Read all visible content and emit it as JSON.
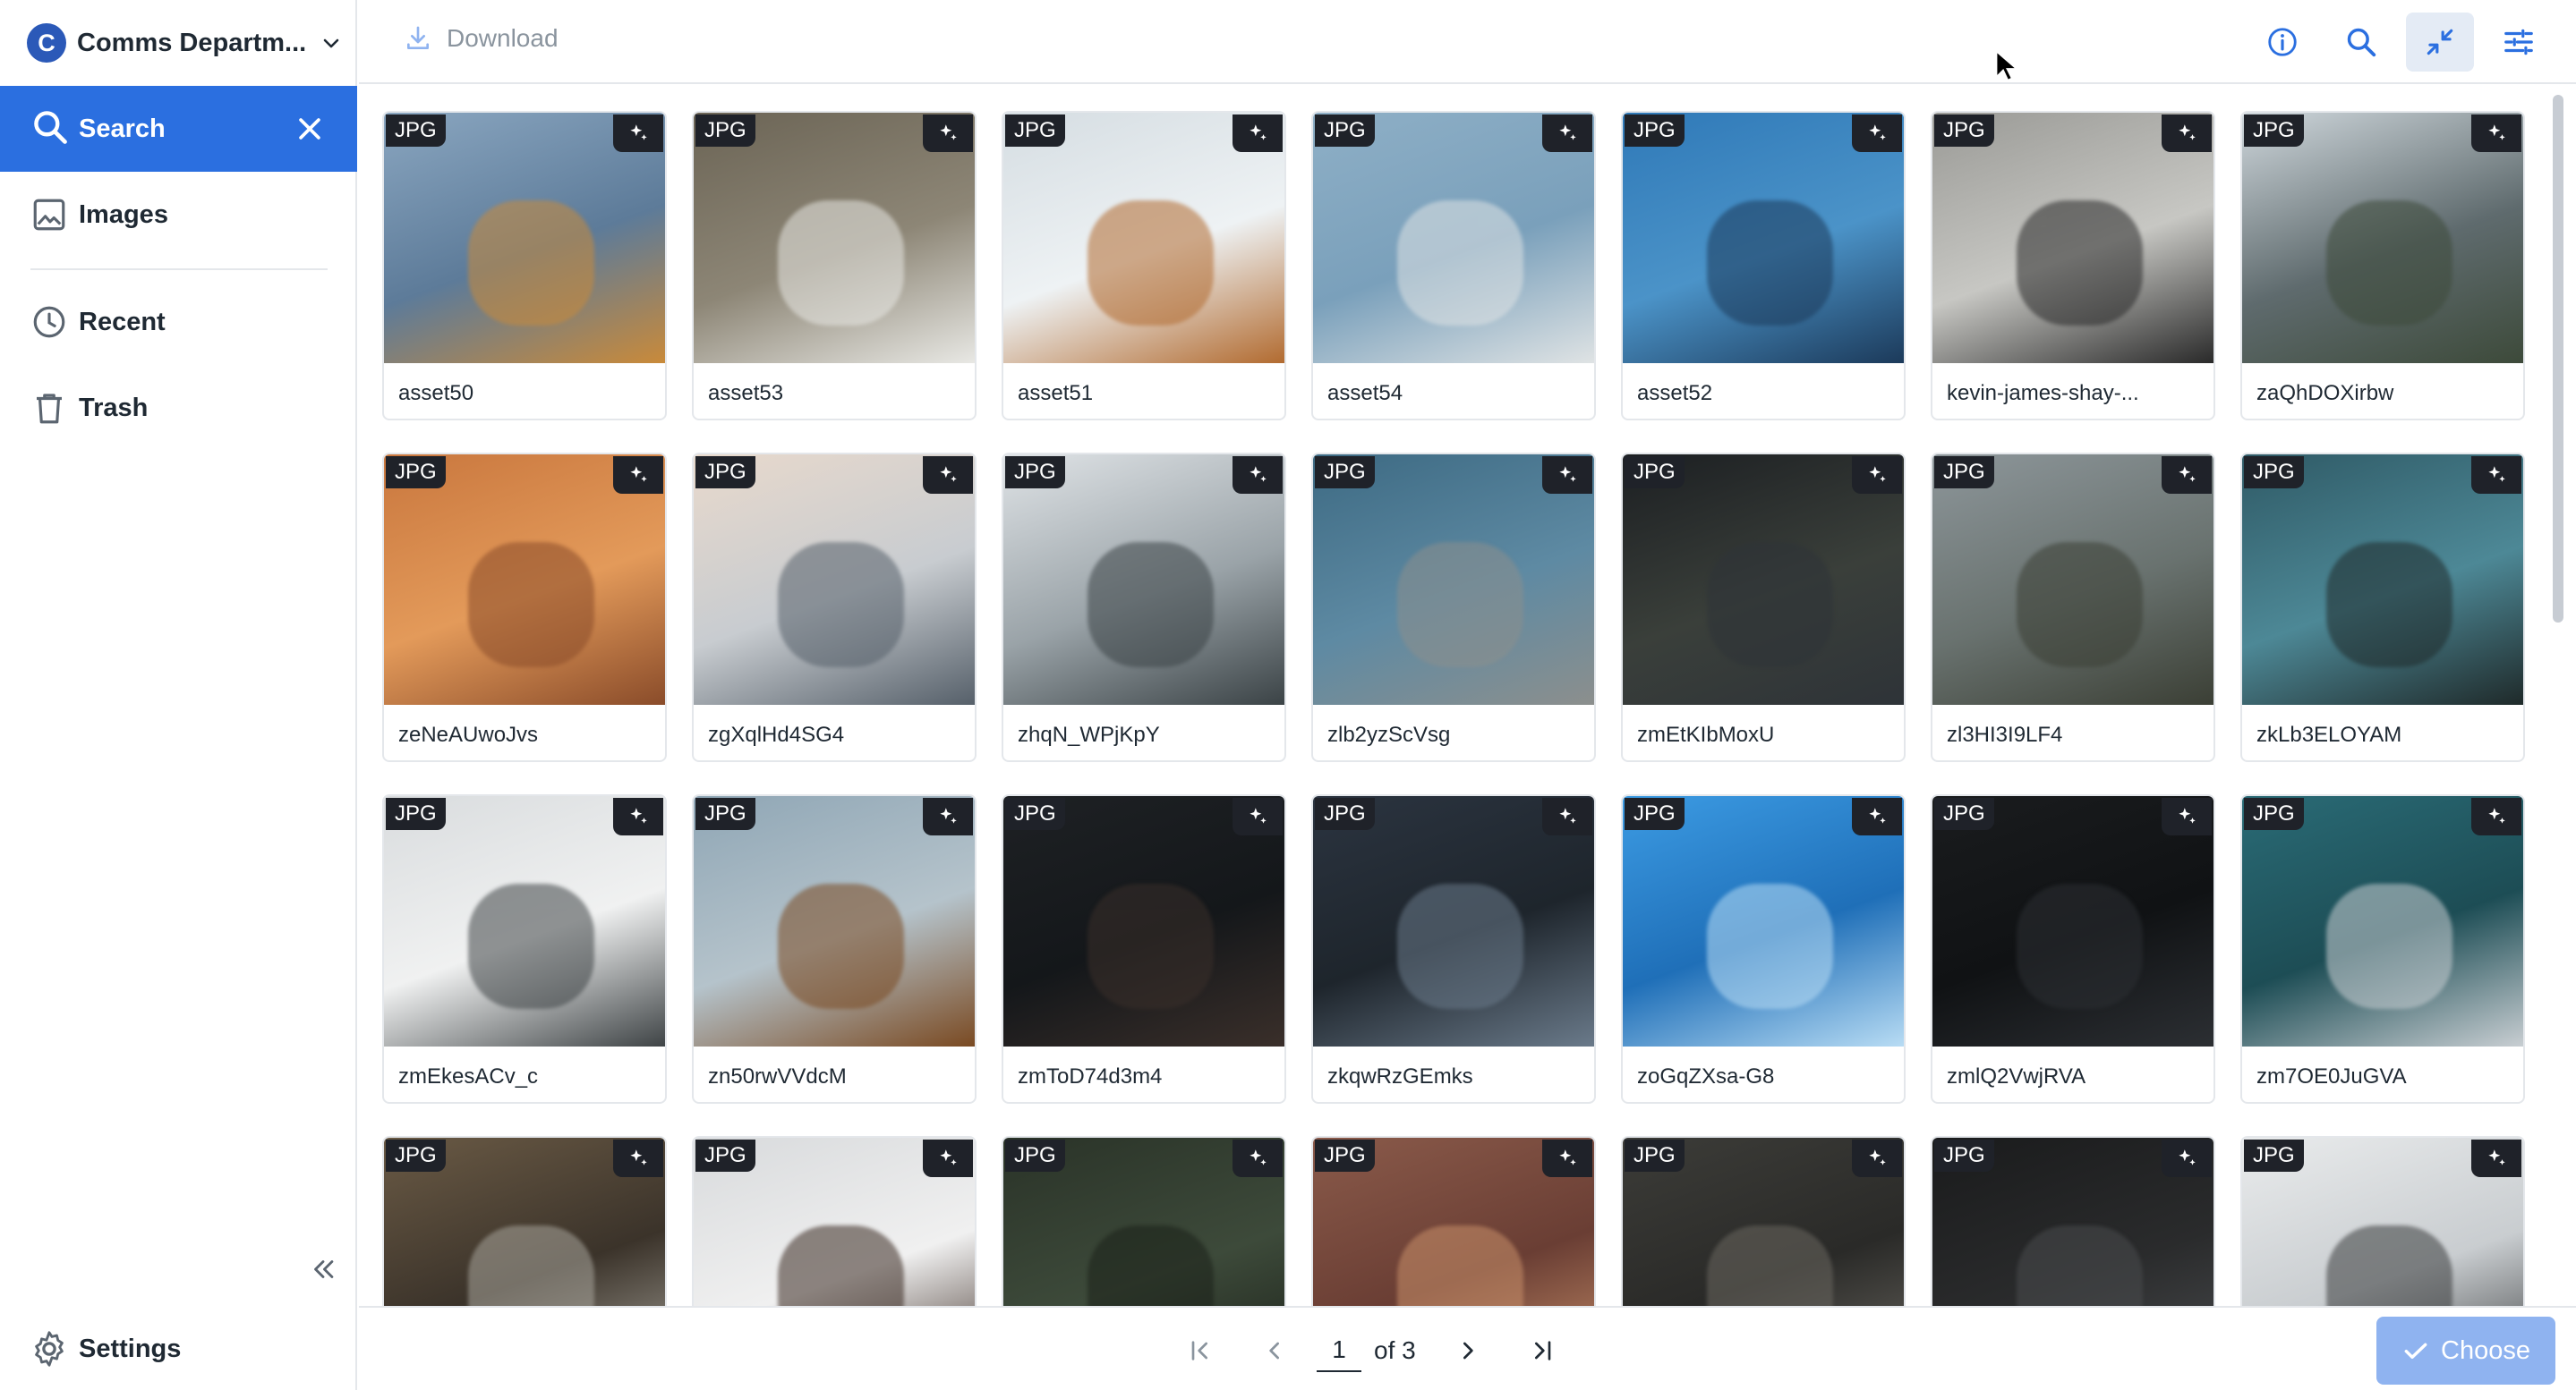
{
  "sidebar": {
    "workspace_initial": "C",
    "workspace_name": "Comms Departm...",
    "search_label": "Search",
    "items": [
      {
        "label": "Images",
        "icon": "image-icon"
      },
      {
        "label": "Recent",
        "icon": "clock-icon"
      },
      {
        "label": "Trash",
        "icon": "trash-icon"
      }
    ],
    "settings_label": "Settings"
  },
  "toolbar": {
    "download_label": "Download",
    "buttons": [
      "info-icon",
      "search-icon",
      "compress-icon",
      "filter-sliders-icon"
    ],
    "active_button": "compress-icon"
  },
  "assets": [
    {
      "name": "asset50",
      "type": "JPG",
      "img": "crane-tower",
      "colors": [
        "#8aa6c0",
        "#c98a3a",
        "#5d7b99"
      ]
    },
    {
      "name": "asset53",
      "type": "JPG",
      "img": "egret-water",
      "colors": [
        "#6b6455",
        "#e8e8e4",
        "#8d8676"
      ]
    },
    {
      "name": "asset51",
      "type": "JPG",
      "img": "crane-sky",
      "colors": [
        "#d5dde2",
        "#b26b30",
        "#eef2f4"
      ]
    },
    {
      "name": "asset54",
      "type": "JPG",
      "img": "egret-flying",
      "colors": [
        "#8eafc6",
        "#dfe3e4",
        "#7aa0bb"
      ]
    },
    {
      "name": "asset52",
      "type": "JPG",
      "img": "crane-blue",
      "colors": [
        "#2f79b8",
        "#1c3a5a",
        "#4b93c8"
      ]
    },
    {
      "name": "kevin-james-shay-...",
      "type": "JPG",
      "img": "protest-crowd",
      "colors": [
        "#9a9a96",
        "#2a2a2a",
        "#c7c7c3"
      ]
    },
    {
      "name": "zaQhDOXirbw",
      "type": "JPG",
      "img": "palm-beach",
      "colors": [
        "#cfd7dc",
        "#3d4a3a",
        "#5f6b6e"
      ]
    },
    {
      "name": "zeNeAUwoJvs",
      "type": "JPG",
      "img": "orange-village",
      "colors": [
        "#c9773e",
        "#8a4c2a",
        "#e39a5a"
      ]
    },
    {
      "name": "zgXqlHd4SG4",
      "type": "JPG",
      "img": "snowy-mountains",
      "colors": [
        "#e8d9cc",
        "#56606a",
        "#c8ccd0"
      ]
    },
    {
      "name": "zhqN_WPjKpY",
      "type": "JPG",
      "img": "snow-forest",
      "colors": [
        "#dfe3e6",
        "#3b4346",
        "#9aa3a8"
      ]
    },
    {
      "name": "zlb2yzScVsg",
      "type": "JPG",
      "img": "rocky-sea",
      "colors": [
        "#3d6a83",
        "#8c8f8d",
        "#5e8aa3"
      ]
    },
    {
      "name": "zmEtKIbMoxU",
      "type": "JPG",
      "img": "night-sky",
      "colors": [
        "#1c1f22",
        "#2e3338",
        "#3a3f3a"
      ]
    },
    {
      "name": "zl3HI3I9LF4",
      "type": "JPG",
      "img": "coast-cliff",
      "colors": [
        "#8d969a",
        "#3b3f35",
        "#69726f"
      ]
    },
    {
      "name": "zkLb3ELOYAM",
      "type": "JPG",
      "img": "coast-aerial",
      "colors": [
        "#2f5a66",
        "#1f2a2a",
        "#4d8896"
      ]
    },
    {
      "name": "zmEkesACv_c",
      "type": "JPG",
      "img": "snowy-mountain-mist",
      "colors": [
        "#d9dcde",
        "#3f4446",
        "#f0f1f1"
      ]
    },
    {
      "name": "zn50rwVVdcM",
      "type": "JPG",
      "img": "giraffe",
      "colors": [
        "#8fa6b5",
        "#7a4a22",
        "#b5c3cb"
      ]
    },
    {
      "name": "zmToD74d3m4",
      "type": "JPG",
      "img": "starry-palms",
      "colors": [
        "#1e2124",
        "#3a2f2a",
        "#14171a"
      ]
    },
    {
      "name": "zkqwRzGEmks",
      "type": "JPG",
      "img": "milky-way",
      "colors": [
        "#2b3440",
        "#6a7a8a",
        "#1e252c"
      ]
    },
    {
      "name": "zoGqZXsa-G8",
      "type": "JPG",
      "img": "blue-fish",
      "colors": [
        "#3c9be3",
        "#b8dcf4",
        "#1f6fb8"
      ]
    },
    {
      "name": "zmlQ2VwjRVA",
      "type": "JPG",
      "img": "night-silhouette",
      "colors": [
        "#1a1c1e",
        "#2c2f33",
        "#101214"
      ]
    },
    {
      "name": "zm7OE0JuGVA",
      "type": "JPG",
      "img": "teal-coast",
      "colors": [
        "#2a6b76",
        "#c8ced2",
        "#1d4d55"
      ]
    },
    {
      "name": "",
      "type": "JPG",
      "img": "canyon",
      "colors": [
        "#6a5a45",
        "#a8a59c",
        "#3b332a"
      ]
    },
    {
      "name": "",
      "type": "JPG",
      "img": "dog",
      "colors": [
        "#d8dadc",
        "#3a2a22",
        "#f0f0f0"
      ]
    },
    {
      "name": "",
      "type": "JPG",
      "img": "forest-aerial",
      "colors": [
        "#2a3328",
        "#1b2119",
        "#3d4a3a"
      ]
    },
    {
      "name": "",
      "type": "JPG",
      "img": "sleeping-cats",
      "colors": [
        "#8a5a4a",
        "#c9906a",
        "#6a3e34"
      ]
    },
    {
      "name": "",
      "type": "JPG",
      "img": "dry-leaves",
      "colors": [
        "#3c3c38",
        "#6a6760",
        "#2a2a28"
      ]
    },
    {
      "name": "",
      "type": "JPG",
      "img": "dark-leaf",
      "colors": [
        "#1a1b1c",
        "#4a4c4e",
        "#2a2b2c"
      ]
    },
    {
      "name": "",
      "type": "JPG",
      "img": "snow-slope",
      "colors": [
        "#e9ebec",
        "#3a3c3d",
        "#c9cdd0"
      ]
    }
  ],
  "pagination": {
    "current_page": "1",
    "of_label": "of 3"
  },
  "footer": {
    "choose_label": "Choose"
  },
  "colors": {
    "accent": "#2b6fe0",
    "choose_disabled": "#8fb3f0",
    "active_tool_bg": "#e4ebf5",
    "badge_bg": "#1f2229"
  }
}
